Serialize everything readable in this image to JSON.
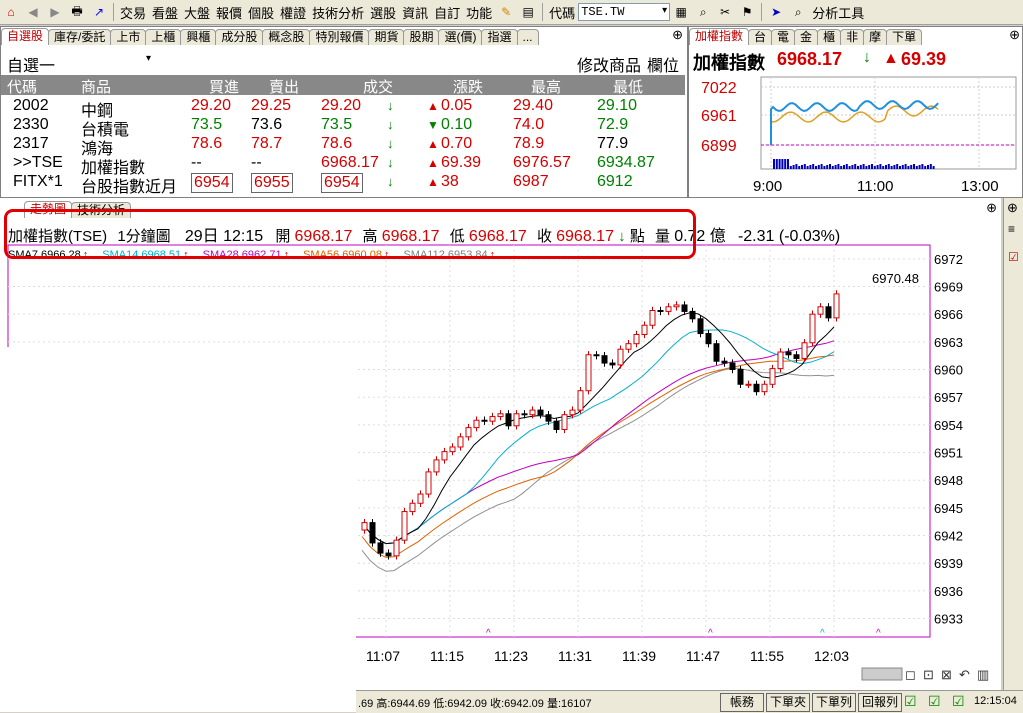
{
  "toolbar": {
    "menus": [
      "交易",
      "看盤",
      "大盤",
      "報價",
      "個股",
      "權證",
      "技術分析",
      "選股",
      "資訊",
      "自訂",
      "功能"
    ],
    "code_label": "代碼",
    "code_value": "TSE.TW",
    "tools_label": "分析工具"
  },
  "watchlist": {
    "tabs": [
      "自選股",
      "庫存/委託",
      "上市",
      "上櫃",
      "興櫃",
      "成分股",
      "概念股",
      "特別報價",
      "期貨",
      "股期",
      "選(價)",
      "指選",
      "..."
    ],
    "list_name": "自選一",
    "modify_label": "修改商品",
    "column_label": "欄位",
    "headers": [
      "代碼",
      "商品",
      "買進",
      "賣出",
      "成交",
      "漲跌",
      "最高",
      "最低"
    ],
    "rows": [
      {
        "code": "2002",
        "name": "中鋼",
        "bid": "29.20",
        "ask": "29.25",
        "last": "29.20",
        "change": "0.05",
        "high": "29.40",
        "low": "29.10",
        "dir": "up"
      },
      {
        "code": "2330",
        "name": "台積電",
        "bid": "73.5",
        "ask": "73.6",
        "last": "73.5",
        "change": "0.10",
        "high": "74.0",
        "low": "72.9",
        "dir": "down"
      },
      {
        "code": "2317",
        "name": "鴻海",
        "bid": "78.6",
        "ask": "78.7",
        "last": "78.6",
        "change": "0.70",
        "high": "78.9",
        "low": "77.9",
        "dir": "up"
      },
      {
        "code": ">>TSE",
        "name": "加權指數",
        "bid": "--",
        "ask": "--",
        "last": "6968.17",
        "change": "69.39",
        "high": "6976.57",
        "low": "6934.87",
        "dir": "up"
      },
      {
        "code": "FITX*1",
        "name": "台股指數近月",
        "bid": "6954",
        "ask": "6955",
        "last": "6954",
        "change": "38",
        "high": "6987",
        "low": "6912",
        "dir": "up"
      }
    ]
  },
  "mini_chart": {
    "tabs": [
      "加權指數",
      "台",
      "電",
      "金",
      "櫃",
      "非",
      "摩",
      "下單"
    ],
    "title": "加權指數",
    "price": "6968.17",
    "change": "69.39",
    "y_labels": [
      "7022",
      "6961",
      "6899"
    ],
    "x_labels": [
      "9:00",
      "11:00",
      "13:00"
    ]
  },
  "tech_chart": {
    "tabs": [
      "走勢圖",
      "技術分析"
    ],
    "info": {
      "symbol": "加權指數(TSE)",
      "period": "1分鐘圖",
      "datetime": "29日 12:15",
      "open_label": "開",
      "open": "6968.17",
      "high_label": "高",
      "high": "6968.17",
      "low_label": "低",
      "low": "6968.17",
      "close_label": "收",
      "close": "6968.17",
      "unit": "點",
      "volume_label": "量",
      "volume": "0.72 億",
      "change": "-2.31 (-0.03%)"
    },
    "ma_labels": [
      {
        "text": "SMA7 6966.28",
        "color": "#000000"
      },
      {
        "text": "SMA14 6968.51",
        "color": "#00b0d0"
      },
      {
        "text": "SMA28 6962.71",
        "color": "#c000c0"
      },
      {
        "text": "SMA56 6960.08",
        "color": "#e06000"
      },
      {
        "text": "SMA112 6953.84",
        "color": "#808080"
      }
    ],
    "last_marker": "6970.48"
  },
  "chart_data": {
    "type": "line",
    "title": "",
    "y_ticks": [
      6972,
      6969,
      6966,
      6963,
      6960,
      6957,
      6954,
      6951,
      6948,
      6945,
      6942,
      6939,
      6936,
      6933
    ],
    "x_ticks": [
      "11:07",
      "11:15",
      "11:23",
      "11:31",
      "11:39",
      "11:47",
      "11:55",
      "12:03"
    ],
    "ylim": [
      6931,
      6973.5
    ],
    "candles_close": [
      6943.4,
      6941.2,
      6940.1,
      6939.8,
      6941.5,
      6944.6,
      6945.5,
      6946.5,
      6948.9,
      6950.2,
      6951.1,
      6951.6,
      6952.7,
      6953.7,
      6954.5,
      6954.4,
      6954.9,
      6955.2,
      6953.9,
      6955.2,
      6955.1,
      6955.6,
      6955.1,
      6954.4,
      6953.5,
      6955.1,
      6955.6,
      6957.7,
      6961.6,
      6961.5,
      6960.7,
      6960.5,
      6962.2,
      6962.8,
      6963.8,
      6964.8,
      6966.4,
      6966.3,
      6966.8,
      6967.0,
      6966.3,
      6965.5,
      6963.9,
      6962.8,
      6960.9,
      6960.7,
      6960.0,
      6958.4,
      6958.4,
      6957.6,
      6958.4,
      6960.1,
      6961.9,
      6961.6,
      6961.2,
      6962.9,
      6966.0,
      6966.8,
      6965.6,
      6968.2
    ],
    "series": []
  },
  "status_bar": {
    "ticker_text": ".69 高:6944.69 低:6942.09 收:6942.09 量:16107",
    "buttons": [
      "帳務",
      "下單夾",
      "下單列",
      "回報列"
    ],
    "time": "12:15:04"
  }
}
